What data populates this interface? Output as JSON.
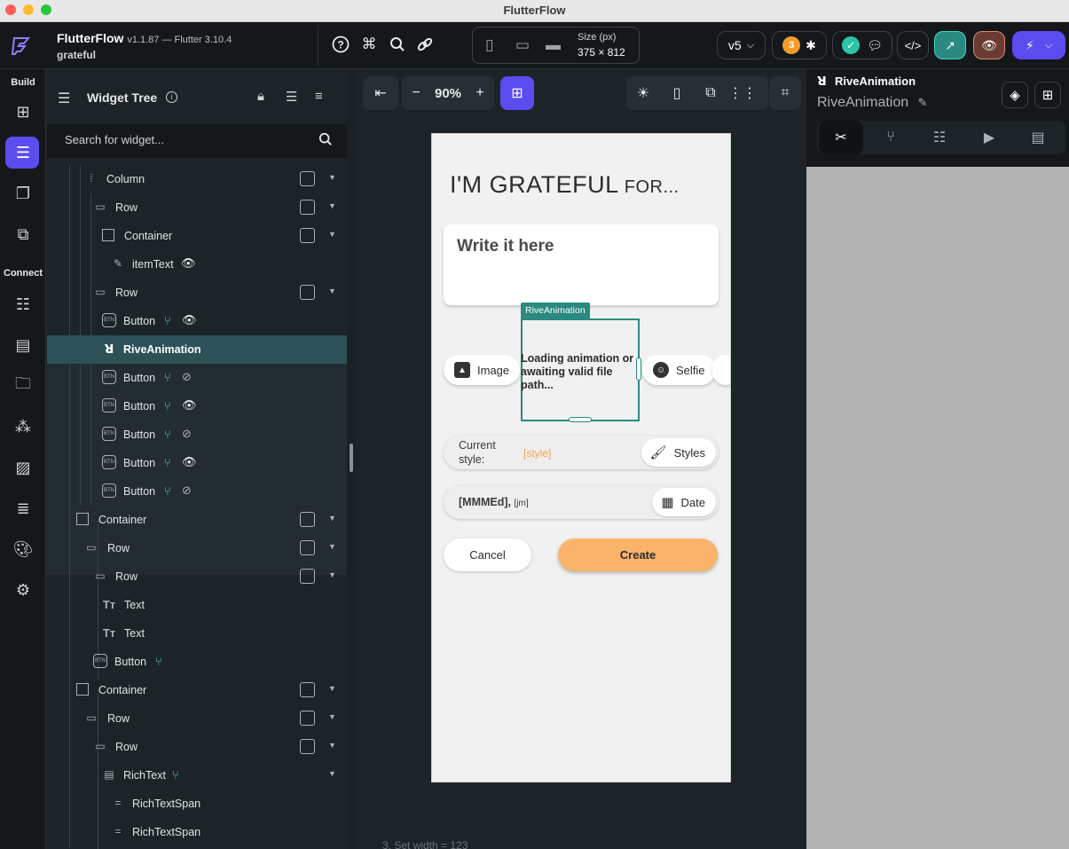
{
  "window": {
    "title": "FlutterFlow"
  },
  "topbar": {
    "app_name": "FlutterFlow",
    "version": "v1.1.87 — Flutter 3.10.4",
    "project": "grateful",
    "size_label": "Size (px)",
    "size_value": "375 × 812",
    "version_select": "v5",
    "issues_count": "3"
  },
  "rail": {
    "build_label": "Build",
    "connect_label": "Connect"
  },
  "tree": {
    "title": "Widget Tree",
    "search_placeholder": "Search for widget...",
    "rows": [
      {
        "label": "Column"
      },
      {
        "label": "Row"
      },
      {
        "label": "Container"
      },
      {
        "label": "itemText"
      },
      {
        "label": "Row"
      },
      {
        "label": "Button"
      },
      {
        "label": "RiveAnimation"
      },
      {
        "label": "Button"
      },
      {
        "label": "Button"
      },
      {
        "label": "Button"
      },
      {
        "label": "Button"
      },
      {
        "label": "Button"
      },
      {
        "label": "Container"
      },
      {
        "label": "Row"
      },
      {
        "label": "Row"
      },
      {
        "label": "Text"
      },
      {
        "label": "Text"
      },
      {
        "label": "Button"
      },
      {
        "label": "Container"
      },
      {
        "label": "Row"
      },
      {
        "label": "Row"
      },
      {
        "label": "RichText"
      },
      {
        "label": "RichTextSpan"
      },
      {
        "label": "RichTextSpan"
      }
    ]
  },
  "canvas": {
    "zoom": "90%",
    "footer_text": "3. Set width = 123",
    "phone": {
      "title_main": "I'M GRATEFUL",
      "title_small": " FOR...",
      "input_placeholder": "Write it here",
      "image_label": "Image",
      "selfie_label": "Selfie",
      "rive_tag": "RiveAnimation",
      "rive_loading": "Loading animation or awaiting valid file path...",
      "style_key": "Current style:",
      "style_value": "[style]",
      "styles_label": "Styles",
      "date_key": "[MMMEd], ",
      "date_value": "[jm]",
      "date_label": "Date",
      "cancel_label": "Cancel",
      "create_label": "Create"
    }
  },
  "props": {
    "title": "RiveAnimation",
    "subtitle": "RiveAnimation"
  },
  "colors": {
    "accent": "#5b4cf0",
    "selection": "#2a8a80",
    "create_button": "#f9b36a",
    "action_icon": "#3ddbb8"
  }
}
